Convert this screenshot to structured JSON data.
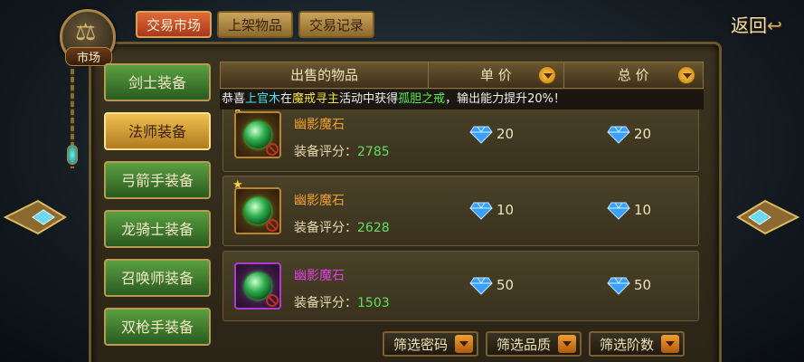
{
  "header": {
    "emblem_label": "市场",
    "tabs": [
      {
        "label": "交易市场",
        "active": true
      },
      {
        "label": "上架物品",
        "active": false
      },
      {
        "label": "交易记录",
        "active": false
      }
    ],
    "back_label": "返回"
  },
  "sidebar": {
    "items": [
      {
        "label": "剑士装备",
        "active": false
      },
      {
        "label": "法师装备",
        "active": true
      },
      {
        "label": "弓箭手装备",
        "active": false
      },
      {
        "label": "龙骑士装备",
        "active": false
      },
      {
        "label": "召唤师装备",
        "active": false
      },
      {
        "label": "双枪手装备",
        "active": false
      }
    ]
  },
  "table": {
    "headers": {
      "item": "出售的物品",
      "unit_price": "单 价",
      "total_price": "总 价"
    },
    "marquee": {
      "prefix": "恭喜",
      "player": "上官木",
      "mid1": "在",
      "event": "魔戒寻主",
      "mid2": "活动中获得",
      "reward": "孤胆之戒",
      "suffix": "，输出能力提升20%！"
    },
    "rows": [
      {
        "name": "幽影魔石",
        "score_label": "装备评分：",
        "score": "2785",
        "unit_price": "20",
        "total_price": "20",
        "quality": "orange",
        "starred": true
      },
      {
        "name": "幽影魔石",
        "score_label": "装备评分：",
        "score": "2628",
        "unit_price": "10",
        "total_price": "10",
        "quality": "orange",
        "starred": true
      },
      {
        "name": "幽影魔石",
        "score_label": "装备评分：",
        "score": "1503",
        "unit_price": "50",
        "total_price": "50",
        "quality": "purple",
        "starred": false
      }
    ]
  },
  "filters": {
    "password": "筛选密码",
    "quality": "筛选品质",
    "tier": "筛选阶数"
  },
  "colors": {
    "tab_active": "#d0502a",
    "sidebar_active": "#e0a838",
    "sidebar_normal": "#4a8a34",
    "gem_blue": "#3aa0ff",
    "score_green": "#60e060"
  }
}
